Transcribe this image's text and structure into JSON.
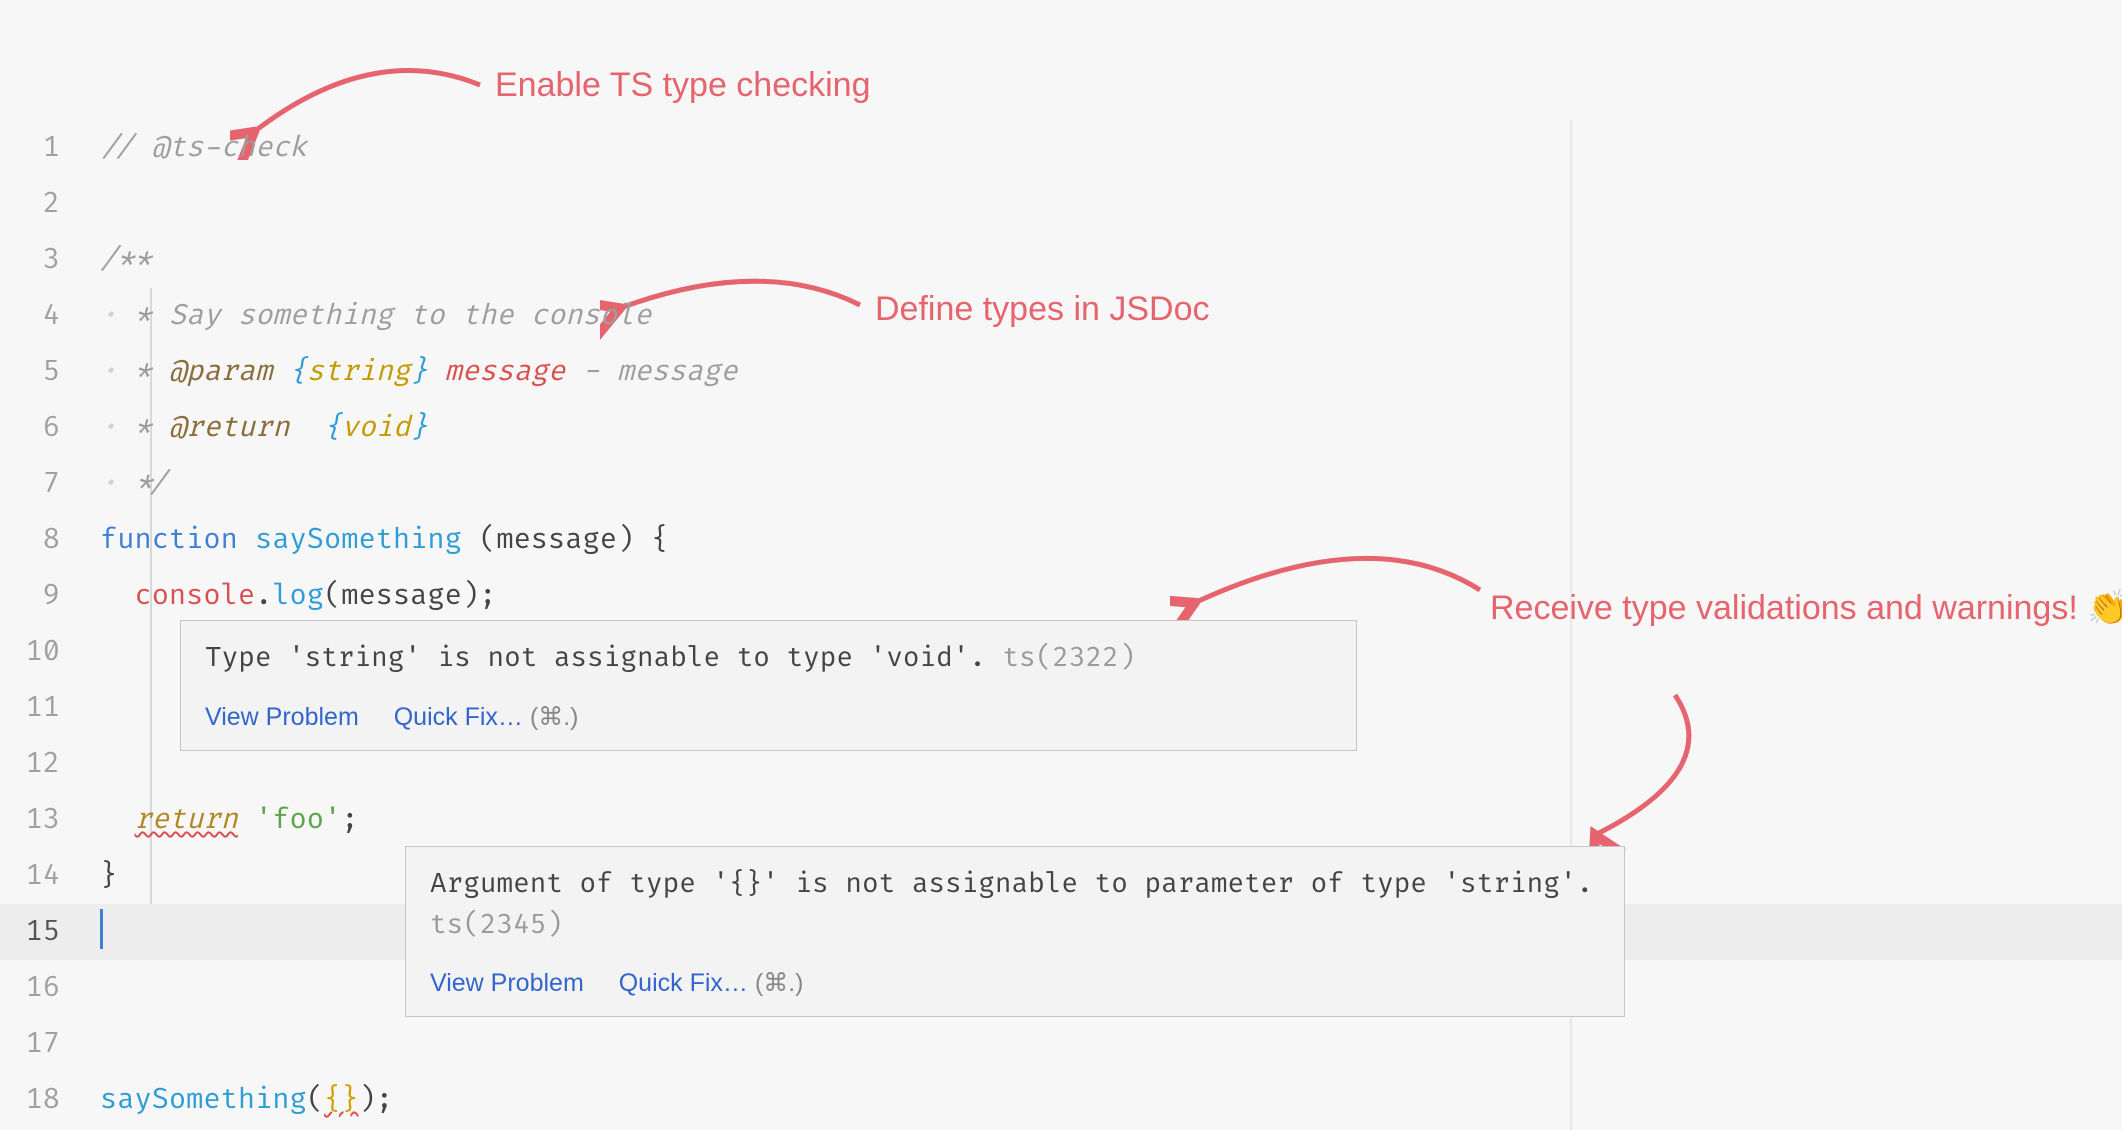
{
  "annotations": {
    "a1": "Enable TS type checking",
    "a2": "Define types in JSDoc",
    "a3": "Receive type validations and warnings! 👏"
  },
  "gutter": [
    "1",
    "2",
    "3",
    "4",
    "5",
    "6",
    "7",
    "8",
    "9",
    "10",
    "11",
    "12",
    "13",
    "14",
    "15",
    "16",
    "17",
    "18"
  ],
  "code": {
    "l1_comment_prefix": "// ",
    "l1_comment_tag": "@ts-check",
    "l3": "/**",
    "l4_star": " * ",
    "l4_text": "Say something to the console",
    "l5_star": " * ",
    "l5_tag": "@param",
    "l5_brace_open": " {",
    "l5_type": "string",
    "l5_brace_close": "} ",
    "l5_name": "message",
    "l5_desc": " - message",
    "l6_star": " * ",
    "l6_tag": "@return",
    "l6_brace_open": "  {",
    "l6_type": "void",
    "l6_brace_close": "} ",
    "l7": " */",
    "l8_fn": "function",
    "l8_name": " saySomething",
    "l8_sig": " (message) {",
    "l9_indent": "  ",
    "l9_obj": "console",
    "l9_dot": ".",
    "l9_method": "log",
    "l9_args": "(message);",
    "l13_indent": "  ",
    "l13_ret": "return",
    "l13_sp": " ",
    "l13_str": "'foo'",
    "l13_semi": ";",
    "l14": "}",
    "l18_call": "saySomething",
    "l18_open": "(",
    "l18_arg": "{}",
    "l18_close": ");"
  },
  "tooltip1": {
    "msg": "Type 'string' is not assignable to type 'void'. ",
    "codenum": "ts(2322)",
    "view": "View Problem",
    "fix": "Quick Fix…",
    "shortcut": "(⌘.)"
  },
  "tooltip2": {
    "msg": "Argument of type '{}' is not assignable to parameter of type 'string'. ",
    "codenum": "ts(2345)",
    "view": "View Problem",
    "fix": "Quick Fix…",
    "shortcut": "(⌘.)"
  }
}
